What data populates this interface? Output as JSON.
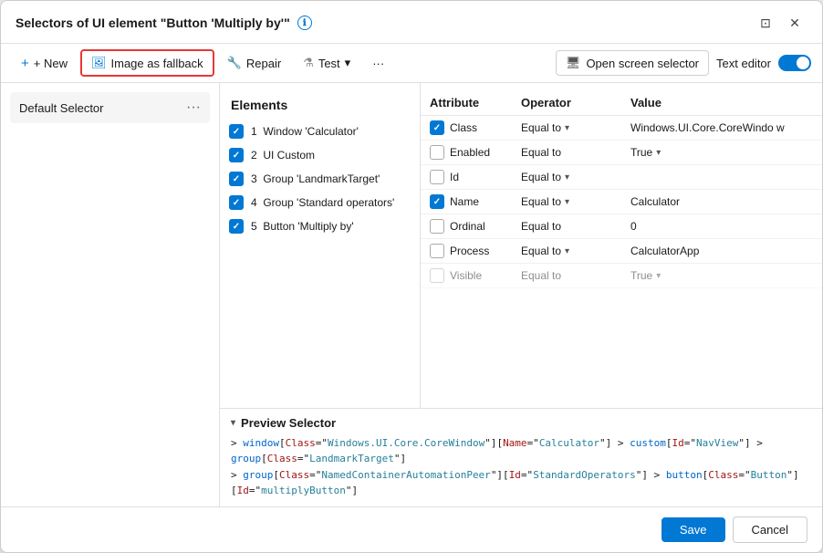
{
  "dialog": {
    "title": "Selectors of UI element \"Button 'Multiply by'\"",
    "title_info_icon": "ℹ",
    "restore_icon": "⬜",
    "close_icon": "✕"
  },
  "toolbar": {
    "new_label": "+ New",
    "image_fallback_label": "Image as fallback",
    "repair_label": "Repair",
    "test_label": "Test",
    "more_icon": "···",
    "open_screen_label": "Open screen selector",
    "text_editor_label": "Text editor",
    "dropdown_icon": "▾"
  },
  "left_panel": {
    "selector_label": "Default Selector"
  },
  "elements": {
    "header": "Elements",
    "items": [
      {
        "index": 1,
        "label": "Window 'Calculator'",
        "checked": true
      },
      {
        "index": 2,
        "label": "UI Custom",
        "checked": true
      },
      {
        "index": 3,
        "label": "Group 'LandmarkTarget'",
        "checked": true
      },
      {
        "index": 4,
        "label": "Group 'Standard operators'",
        "checked": true
      },
      {
        "index": 5,
        "label": "Button 'Multiply by'",
        "checked": true
      }
    ]
  },
  "attributes": {
    "col_attribute": "Attribute",
    "col_operator": "Operator",
    "col_value": "Value",
    "rows": [
      {
        "checked": true,
        "name": "Class",
        "operator": "Equal to",
        "has_dropdown": true,
        "value": "Windows.UI.Core.CoreWindow"
      },
      {
        "checked": false,
        "name": "Enabled",
        "operator": "Equal to",
        "has_dropdown": false,
        "value": "True",
        "value_dropdown": true
      },
      {
        "checked": false,
        "name": "Id",
        "operator": "Equal to",
        "has_dropdown": true,
        "value": ""
      },
      {
        "checked": true,
        "name": "Name",
        "operator": "Equal to",
        "has_dropdown": true,
        "value": "Calculator"
      },
      {
        "checked": false,
        "name": "Ordinal",
        "operator": "Equal to",
        "has_dropdown": false,
        "value": "0"
      },
      {
        "checked": false,
        "name": "Process",
        "operator": "Equal to",
        "has_dropdown": true,
        "value": "CalculatorApp"
      },
      {
        "checked": false,
        "name": "Visible",
        "operator": "Equal to",
        "has_dropdown": false,
        "value": "True"
      }
    ]
  },
  "preview": {
    "header": "Preview Selector",
    "line1_prefix": "> ",
    "line1": "window[Class=\"Windows.UI.Core.CoreWindow\"][Name=\"Calculator\"] > custom[Id=\"NavView\"] > group[Class=\"LandmarkTarget\"]",
    "line2_prefix": "> ",
    "line2": "group[Class=\"NamedContainerAutomationPeer\"][Id=\"StandardOperators\"] > button[Class=\"Button\"][Id=\"multiplyButton\"]"
  },
  "footer": {
    "save_label": "Save",
    "cancel_label": "Cancel"
  }
}
